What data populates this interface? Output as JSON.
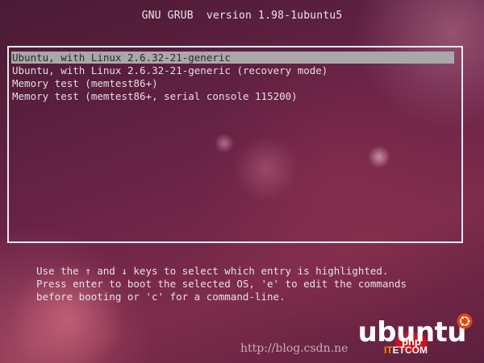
{
  "header": {
    "title": "GNU GRUB  version 1.98-1ubuntu5"
  },
  "menu": {
    "entries": [
      {
        "label": "Ubuntu, with Linux 2.6.32-21-generic",
        "selected": true
      },
      {
        "label": "Ubuntu, with Linux 2.6.32-21-generic (recovery mode)",
        "selected": false
      },
      {
        "label": "Memory test (memtest86+)",
        "selected": false
      },
      {
        "label": "Memory test (memtest86+, serial console 115200)",
        "selected": false
      }
    ]
  },
  "instructions": {
    "line1": "Use the ↑ and ↓ keys to select which entry is highlighted.",
    "line2": "Press enter to boot the selected OS, 'e' to edit the commands",
    "line3": "before booting or 'c' for a command-line."
  },
  "branding": {
    "logo_text": "ubuntu",
    "icon": "circle-of-friends-icon",
    "accent_color": "#dd4814"
  },
  "watermark": {
    "url": "http://blog.csdn.ne",
    "badge": "php",
    "site_prefix": "IT",
    "site_suffix": "ETCOM"
  }
}
